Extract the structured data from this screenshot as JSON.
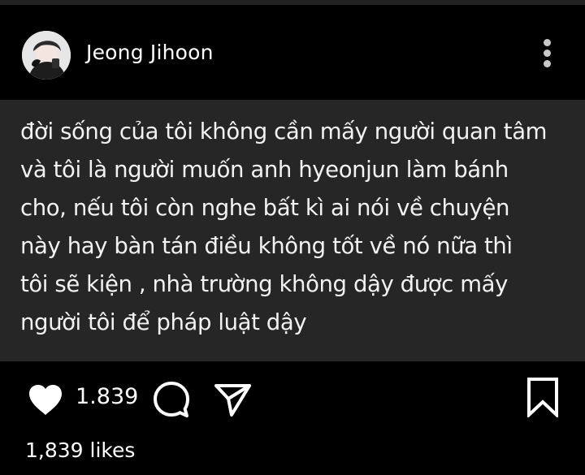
{
  "post": {
    "username": "Jeong Jihoon",
    "caption": "đời sống của tôi không cần mấy người quan tâm\nvà tôi là người muốn anh hyeonjun làm bánh\ncho, nếu tôi còn nghe bất kì ai nói về chuyện\nnày hay bàn tán điều không tốt về nó nữa thì\ntôi sẽ kiện , nhà trường không dậy được mấy\nngười tôi để pháp luật dậy",
    "like_count": "1.839",
    "likes_text": "1,839 likes"
  },
  "icons": {
    "avatar": "avatar-photo",
    "more": "more-vertical-icon",
    "like": "heart-icon",
    "comment": "comment-icon",
    "share": "send-icon",
    "bookmark": "bookmark-icon"
  },
  "colors": {
    "background": "#000000",
    "post_background": "#262626",
    "text": "#ffffff",
    "more_dots": "#c9c9c9"
  }
}
